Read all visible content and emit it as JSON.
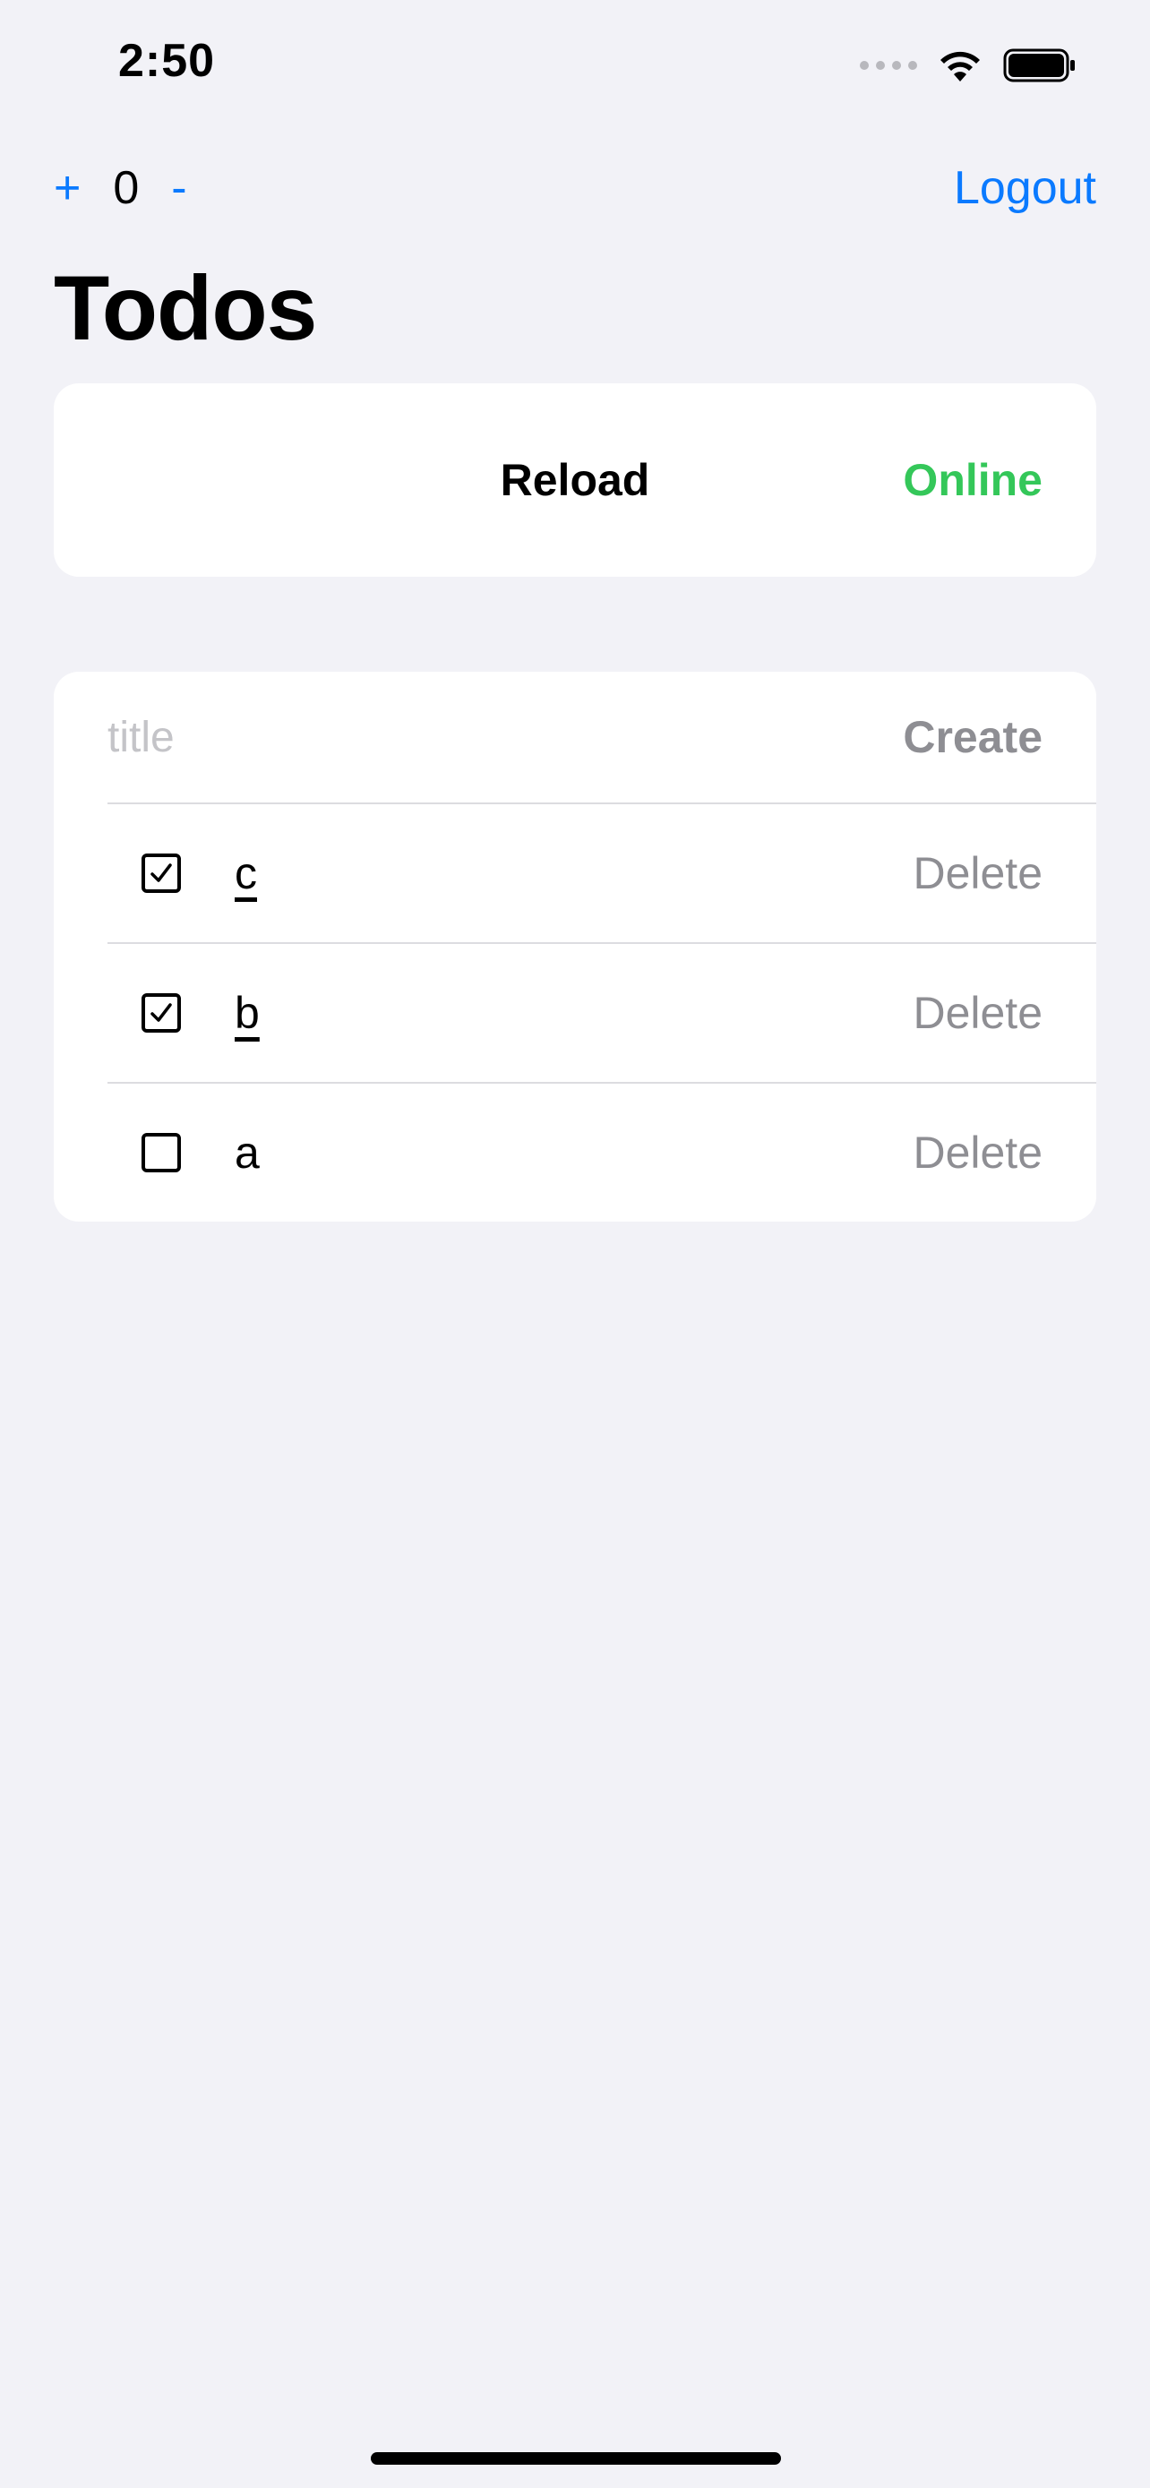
{
  "status_bar": {
    "time": "2:50"
  },
  "nav": {
    "increment_label": "+",
    "counter_value": "0",
    "decrement_label": "-",
    "logout_label": "Logout"
  },
  "page": {
    "title": "Todos"
  },
  "reload_card": {
    "reload_label": "Reload",
    "status_label": "Online",
    "status_color": "#34c759"
  },
  "todo_form": {
    "title_value": "",
    "title_placeholder": "title",
    "create_label": "Create"
  },
  "todos": [
    {
      "title": "c",
      "done": true,
      "delete_label": "Delete"
    },
    {
      "title": "b",
      "done": true,
      "delete_label": "Delete"
    },
    {
      "title": "a",
      "done": false,
      "delete_label": "Delete"
    }
  ],
  "colors": {
    "accent": "#0a7aff",
    "background": "#f2f2f7",
    "muted": "#8e8e93"
  }
}
